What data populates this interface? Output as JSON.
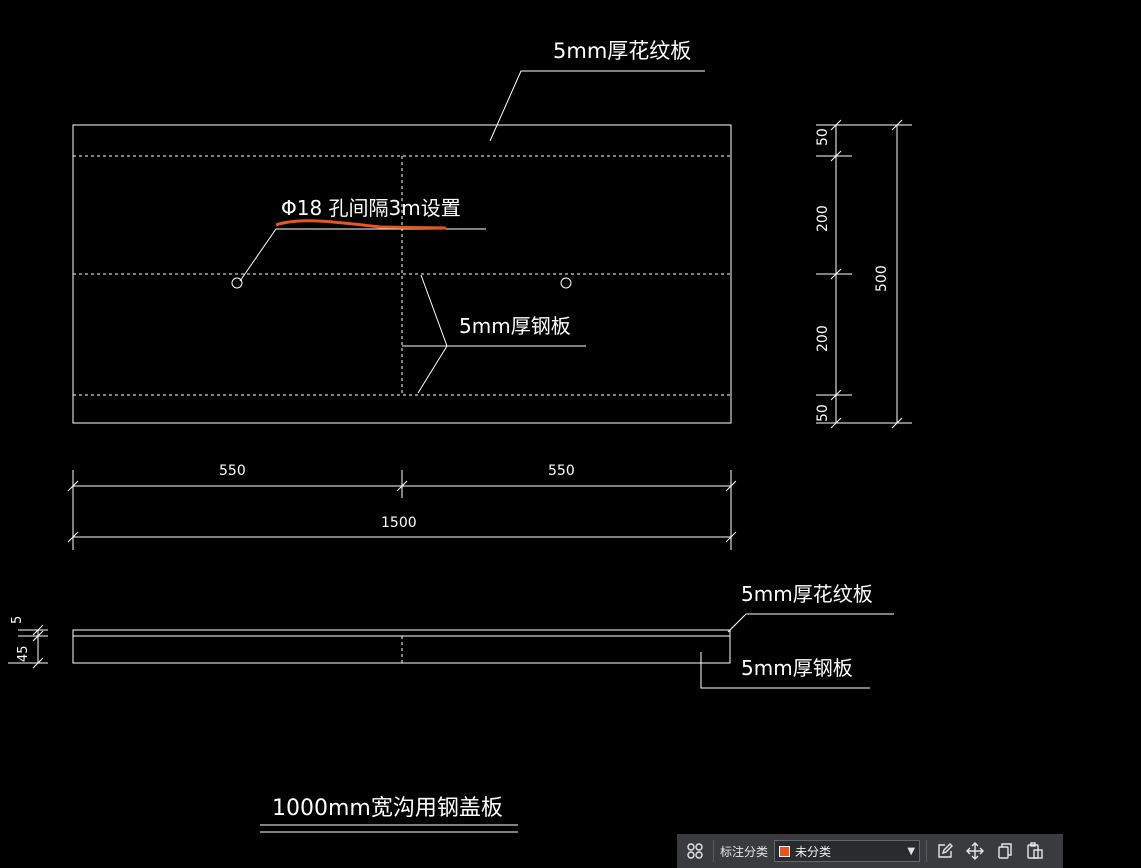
{
  "drawing": {
    "label_top_plate": "5mm厚花纹板",
    "label_hole": "Φ18 孔间隔3m设置",
    "label_steel_plate": "5mm厚钢板",
    "dim_top_50": "50",
    "dim_200_a": "200",
    "dim_200_b": "200",
    "dim_bottom_50": "50",
    "dim_500": "500",
    "dim_550_left": "550",
    "dim_550_right": "550",
    "dim_1500": "1500",
    "section_label_top_plate": "5mm厚花纹板",
    "section_label_steel_plate": "5mm厚钢板",
    "dim_5": "5",
    "dim_45": "45",
    "title": "1000mm宽沟用钢盖板"
  },
  "toolbar": {
    "label": "标注分类",
    "selected_category": "未分类",
    "swatch_color": "#e8561c",
    "icons": [
      "grid-icon",
      "edit-icon",
      "move-icon",
      "copy-icon",
      "paste-icon"
    ]
  },
  "colors": {
    "background": "#000000",
    "lines": "#ffffff",
    "highlight": "#e8561c"
  }
}
